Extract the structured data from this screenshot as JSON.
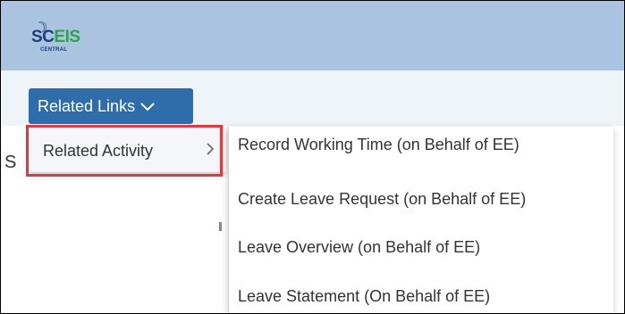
{
  "header": {
    "logo_sc": "SC",
    "logo_eis": "EIS",
    "logo_sub": "CENTRAL"
  },
  "toolbar": {
    "related_links_label": "Related Links"
  },
  "main": {
    "partial_heading": "S"
  },
  "menu_level1": {
    "items": [
      {
        "label": "Related Activity"
      }
    ]
  },
  "menu_level2": {
    "items": [
      {
        "label": "Record Working Time (on Behalf of EE)"
      },
      {
        "label": "Create Leave Request (on Behalf of EE)"
      },
      {
        "label": "Leave Overview (on Behalf of EE)"
      },
      {
        "label": "Leave Statement (On Behalf of EE)"
      }
    ]
  },
  "colors": {
    "header_bg": "#a9c3e0",
    "button_bg": "#2f6caa",
    "highlight_border": "#e8363a"
  }
}
